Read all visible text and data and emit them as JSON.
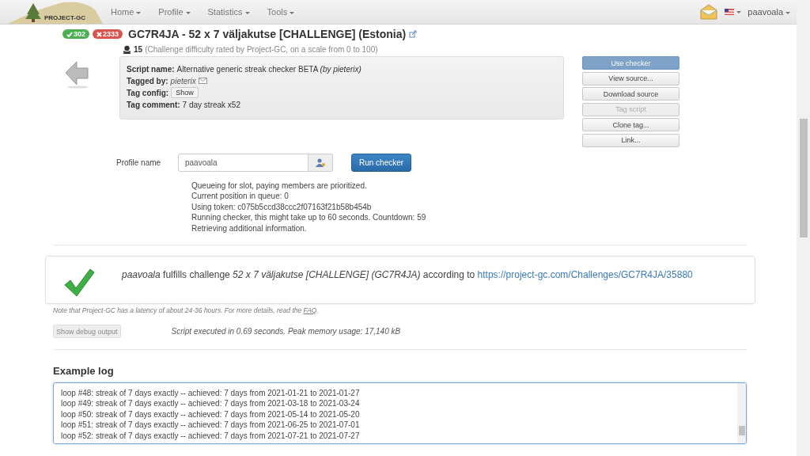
{
  "navbar": {
    "logo": "PROJECT-GC",
    "menu": [
      "Home",
      "Profile",
      "Statistics",
      "Tools"
    ],
    "user": "paavoala"
  },
  "challenge": {
    "found_count": "302",
    "dnf_count": "2333",
    "title": "GC7R4JA - 52 x 7 väljakutse [CHALLENGE] (Estonia)",
    "difficulty": "15",
    "difficulty_note": "(Challenge difficulty rated by Project-GC, on a scale from 0 to 100)"
  },
  "script_info": [
    {
      "kind": "text",
      "label": "Script name:",
      "value": "Alternative generic streak checker BETA *(by pieterix)*"
    },
    {
      "kind": "user",
      "label": "Tagged by:",
      "value": "pieterix"
    },
    {
      "kind": "button",
      "label": "Tag config:",
      "value": "Show"
    },
    {
      "kind": "text",
      "label": "Tag comment:",
      "value": "7 day streak x52"
    }
  ],
  "actions": [
    {
      "label": "Use checker",
      "selected": true,
      "disabled": false
    },
    {
      "label": "View source...",
      "selected": false,
      "disabled": false
    },
    {
      "label": "Download source",
      "selected": false,
      "disabled": false
    },
    {
      "label": "Tag script",
      "selected": false,
      "disabled": true
    },
    {
      "label": "Clone tag...",
      "selected": false,
      "disabled": false
    },
    {
      "label": "Link...",
      "selected": false,
      "disabled": false
    }
  ],
  "profile": {
    "label": "Profile name",
    "value": "paavoala",
    "button": "Run checker"
  },
  "status_lines": [
    "Queueing for slot, paying members are prioritized.",
    "Current position in queue: 0",
    "Using token: c075b5ccd38ccc2f07163f21b58b454b",
    "Running checker, this might take up to 60 seconds. Countdown: 59",
    "Retrieving additional information."
  ],
  "result": {
    "passed": true,
    "text": "*paavoala* fulfills challenge *52 x 7 väljakutse [CHALLENGE] (GC7R4JA)* according to",
    "link": "https://project-gc.com/Challenges/GC7R4JA/35880"
  },
  "note": {
    "text": "Note that Project-GC has a latency of about 24-36 hours. For more details, read the",
    "link": "FAQ",
    "end": "."
  },
  "debug_button": "Show debug output",
  "execution": "Script executed in 0.69 seconds. Peak memory usage: 17,140 kB",
  "example_log": {
    "title": "Example log",
    "lines": [
      "loop #48: streak of 7 days exactly -- achieved: 7 days from 2021-01-21 to 2021-01-27",
      "loop #49: streak of 7 days exactly -- achieved: 7 days from 2021-03-18 to 2021-03-24",
      "loop #50: streak of 7 days exactly -- achieved: 7 days from 2021-05-14 to 2021-05-20",
      "loop #51: streak of 7 days exactly -- achieved: 7 days from 2021-06-25 to 2021-07-01",
      "loop #52: streak of 7 days exactly -- achieved: 7 days from 2021-07-21 to 2021-07-27"
    ]
  }
}
